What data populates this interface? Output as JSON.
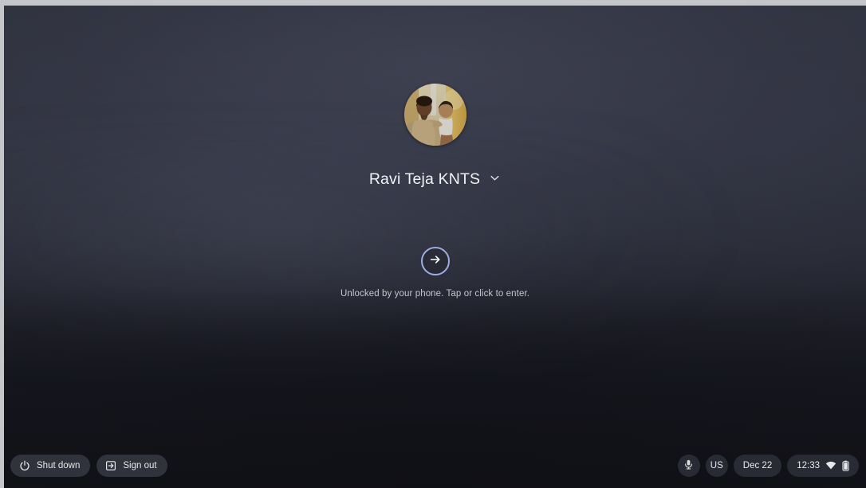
{
  "screen": {
    "type": "chromeos-lock-screen",
    "background_color": "#23242e",
    "frame_color": "#c5c6ca"
  },
  "user_pod": {
    "avatar": {
      "icon": "user-avatar-photo",
      "description": "Photo of a man in a cream shirt holding a baby",
      "colors": {
        "backdrop": "#c9a45a",
        "wall": "#e8dcb4",
        "shirt": "#c9b184",
        "skin": "#6d4628",
        "baby_outfit": "#f2f0e8"
      }
    },
    "name": "Ravi Teja KNTS",
    "chevron_icon": "chevron-down-icon"
  },
  "unlock": {
    "arrow_icon": "arrow-right-icon",
    "arrow_border_color": "#9aafe0",
    "hint": "Unlocked by your phone. Tap or click to enter."
  },
  "shelf": {
    "left_buttons": [
      {
        "id": "shut-down",
        "label": "Shut down",
        "icon": "power-icon"
      },
      {
        "id": "sign-out",
        "label": "Sign out",
        "icon": "exit-icon"
      }
    ],
    "tray": {
      "microphone": {
        "icon": "microphone-icon",
        "label": ""
      },
      "keyboard_layout": "US",
      "date": "Dec 22",
      "time": "12:33",
      "network_icon": "wifi-icon",
      "battery_icon": "battery-icon"
    }
  }
}
